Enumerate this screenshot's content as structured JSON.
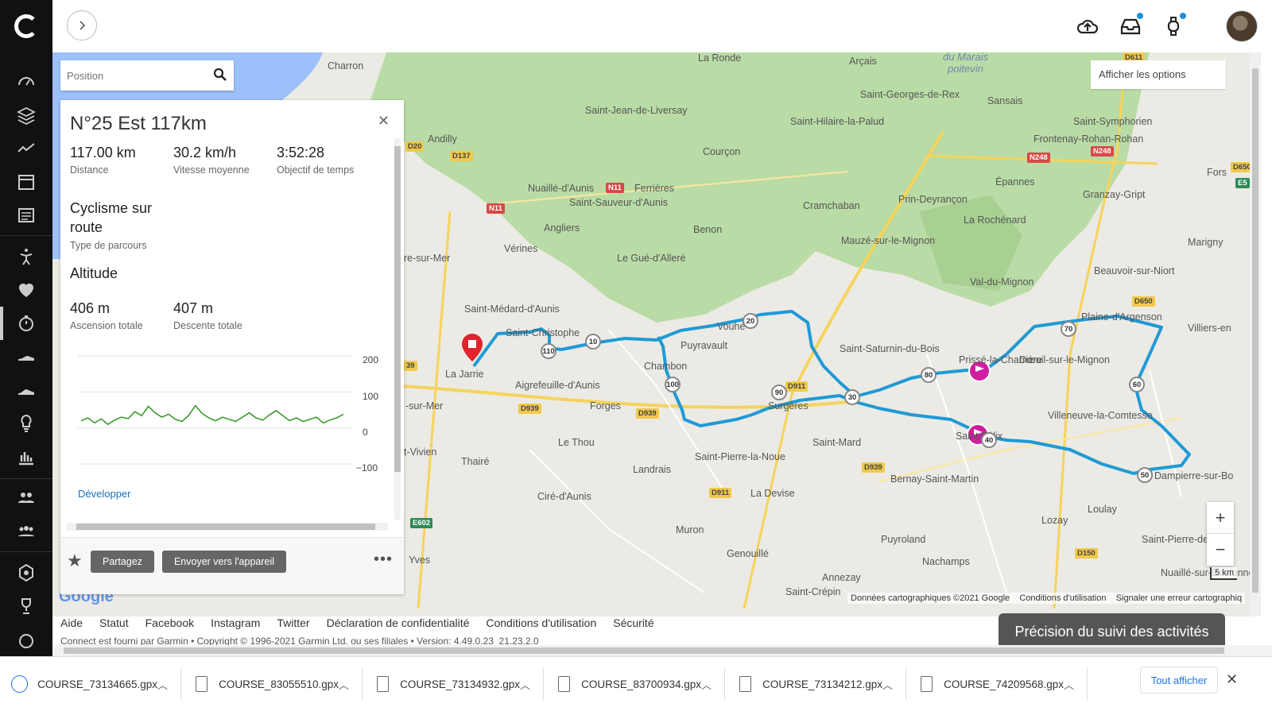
{
  "nav": {
    "icons": [
      "dashboard-icon",
      "layers-icon",
      "trend-icon",
      "calendar-icon",
      "news-icon",
      "activity-person-icon",
      "heart-icon",
      "stopwatch-icon",
      "shoe-icon",
      "running-shoe-icon",
      "lightbulb-icon",
      "bar-chart-icon",
      "connections-icon",
      "groups-icon",
      "badge-icon",
      "trophy-icon",
      "gauge-icon"
    ]
  },
  "top": {
    "icons": [
      "upload-cloud-icon",
      "inbox-icon",
      "watch-icon"
    ]
  },
  "search": {
    "placeholder": "Position"
  },
  "options_label": "Afficher les options",
  "course": {
    "title": "N°25 Est 117km",
    "stats": [
      {
        "value": "117.00 km",
        "label": "Distance"
      },
      {
        "value": "30.2 km/h",
        "label": "Vitesse moyenne"
      },
      {
        "value": "3:52:28",
        "label": "Objectif de temps"
      }
    ],
    "route_type_value": "Cyclisme sur route",
    "route_type_label": "Type de parcours",
    "altitude_heading": "Altitude",
    "ascent": {
      "value": "406 m",
      "label": "Ascension totale"
    },
    "descent": {
      "value": "407 m",
      "label": "Descente totale"
    },
    "chart_ticks": [
      "200",
      "100",
      "0",
      "−100"
    ],
    "develop_link": "Développer",
    "share_button": "Partagez",
    "send_button": "Envoyer vers l'appareil"
  },
  "chart_data": {
    "type": "line",
    "title": "",
    "xlabel": "",
    "ylabel": "",
    "ylim": [
      -100,
      200
    ],
    "series": [
      {
        "values": [
          20,
          28,
          14,
          25,
          10,
          22,
          30,
          26,
          45,
          34,
          60,
          42,
          30,
          38,
          24,
          18,
          35,
          62,
          40,
          28,
          20,
          30,
          24,
          18,
          30,
          42,
          28,
          22,
          36,
          48,
          34,
          20,
          28,
          18,
          24,
          30,
          14,
          22,
          28,
          38
        ]
      }
    ]
  },
  "map_labels": {
    "towns": [
      "Charron",
      "La Ronde",
      "Arçais",
      "Saint-Jean-de-Liversay",
      "Saint-Hilaire-la-Palud",
      "Saint-Georges-de-Rex",
      "Sansais",
      "Andilly",
      "Courçon",
      "Saint-Symphorien",
      "Frontenay-Rohan-Rohan",
      "Nuaillé-d'Aunis",
      "Ferrières",
      "Saint-Sauveur-d'Aunis",
      "Cramchaban",
      "Épannes",
      "Granzay-Gript",
      "Fors",
      "Prin-Deyrançon",
      "Angliers",
      "Benon",
      "La Rochénard",
      "Vérines",
      "Le Gué-d'Alleré",
      "Mauzé-sur-le-Mignon",
      "Marigny",
      "Beauvoir-sur-Niort",
      "Val-du-Mignon",
      "Saint-Médard-d'Aunis",
      "Plaine-d'Argenson",
      "Villiers-en",
      "Saint-Christophe",
      "Puyravault",
      "Saint-Saturnin-du-Bois",
      "La Jarrie",
      "Chambon",
      "Prissé-la-Charrière",
      "Aigrefeuille-d'Aunis",
      "Forges",
      "Surgères",
      "Dœuil-sur-le-Mignon",
      "Villeneuve-la-Comtesse",
      "Vouhé",
      "Le Thou",
      "Saint-Mard",
      "Saint-Félix",
      "Thairé",
      "Saint-Pierre-la-Noue",
      "Landrais",
      "Bernay-Saint-Martin",
      "Dampierre-sur-Bo",
      "Ciré-d'Aunis",
      "La Devise",
      "Loulay",
      "Lozay",
      "Muron",
      "Saint-Pierre-de",
      "Puyroland",
      "Genouillé",
      "Nachamps",
      "Annezay",
      "Saint-Crépin",
      "Yves",
      "Nuaillé-sur-Boutonne",
      "t-Vivien",
      "-sur-Mer",
      "re-sur-Mer"
    ],
    "marais": [
      "du Marais",
      "poitevin"
    ],
    "roads": [
      "D611",
      "D20",
      "D137",
      "N11",
      "N11",
      "N248",
      "N248",
      "D650",
      "E5",
      "D650",
      "D939",
      "D939",
      "D911",
      "D939",
      "D911",
      "E602",
      "D150",
      "39"
    ],
    "km_markers": [
      "110",
      "10",
      "20",
      "100",
      "90",
      "30",
      "80",
      "70",
      "60",
      "40",
      "50"
    ]
  },
  "map_footer": {
    "data": "Données cartographiques ©2021 Google",
    "terms": "Conditions d'utilisation",
    "report": "Signaler une erreur cartographiq",
    "scale": "5 km",
    "google": "Google"
  },
  "footer": {
    "links": [
      "Aide",
      "Statut",
      "Facebook",
      "Instagram",
      "Twitter",
      "Déclaration de confidentialité",
      "Conditions d'utilisation",
      "Sécurité"
    ],
    "copyright": "Connect est fourni par Garmin • Copyright © 1996-2021 Garmin Ltd. ou ses filiales • Version: 4.49.0.23_21.23.2.0",
    "precision_button": "Précision du suivi des activités"
  },
  "downloads": {
    "files": [
      "COURSE_73134665.gpx",
      "COURSE_83055510.gpx",
      "COURSE_73134932.gpx",
      "COURSE_83700934.gpx",
      "COURSE_73134212.gpx",
      "COURSE_74209568.gpx"
    ],
    "show_all": "Tout afficher"
  }
}
